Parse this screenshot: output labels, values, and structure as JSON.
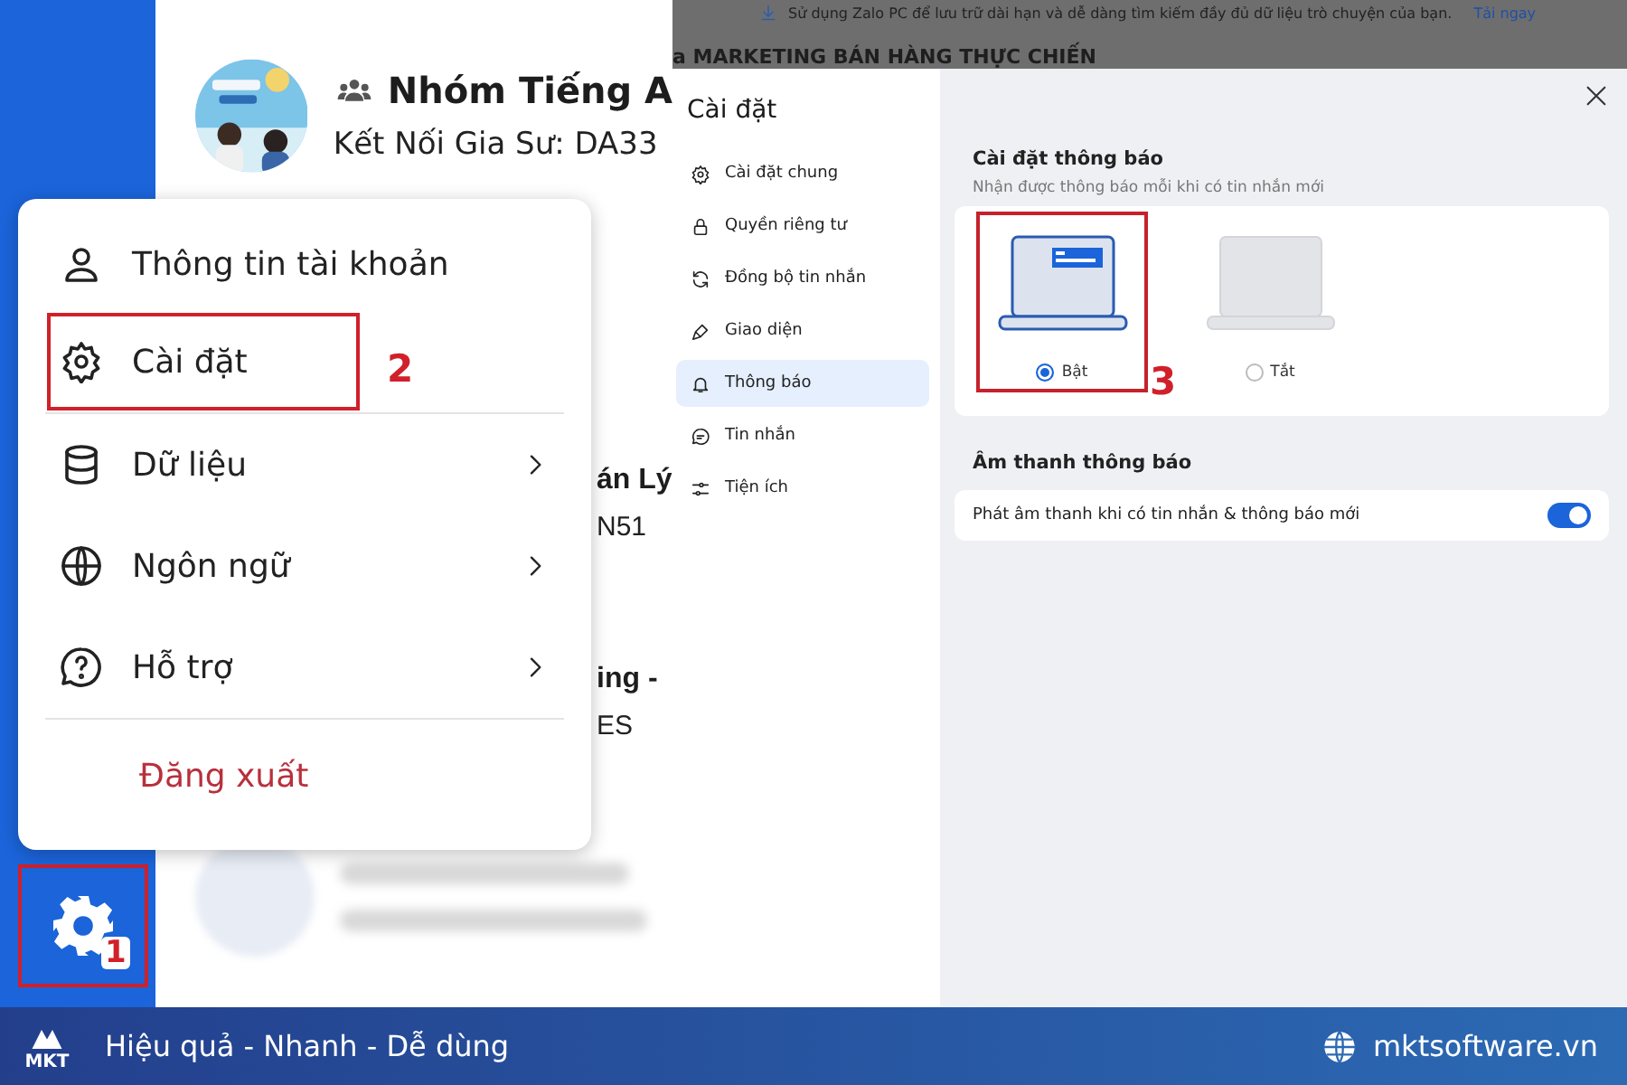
{
  "sidebar": {
    "settings_button": {
      "highlighted": true
    }
  },
  "banner": {
    "text": "Sử dụng Zalo PC để lưu trữ dài hạn và dễ dàng tìm kiếm đầy đủ dữ liệu trò chuyện của bạn.",
    "link": "Tải ngay"
  },
  "chat_header": "a MARKETING BÁN HÀNG THỰC CHIẾN",
  "chats": [
    {
      "kind": "group",
      "title": "Nhóm Tiếng A",
      "subtitle": "Kết Nối Gia Sư: DA33"
    },
    {
      "kind": "partial",
      "title": "án Lý",
      "subtitle": "N51"
    },
    {
      "kind": "partial",
      "title": "ing -",
      "subtitle": "ES"
    },
    {
      "kind": "blurred"
    }
  ],
  "account_menu": {
    "groups": [
      {
        "items": [
          {
            "label": "Thông tin tài khoản",
            "submenu": false,
            "kind": "normal",
            "highlighted": false
          },
          {
            "label": "Cài đặt",
            "submenu": false,
            "kind": "normal",
            "highlighted": true
          }
        ]
      },
      {
        "items": [
          {
            "label": "Dữ liệu",
            "submenu": true,
            "kind": "normal",
            "highlighted": false
          },
          {
            "label": "Ngôn ngữ",
            "submenu": true,
            "kind": "normal",
            "highlighted": false
          },
          {
            "label": "Hỗ trợ",
            "submenu": true,
            "kind": "normal",
            "highlighted": false
          }
        ]
      },
      {
        "items": [
          {
            "label": "Đăng xuất",
            "submenu": false,
            "kind": "danger",
            "highlighted": false
          }
        ]
      }
    ]
  },
  "settings": {
    "title": "Cài đặt",
    "nav": [
      {
        "label": "Cài đặt chung",
        "selected": false
      },
      {
        "label": "Quyền riêng tư",
        "selected": false
      },
      {
        "label": "Đồng bộ tin nhắn",
        "selected": false
      },
      {
        "label": "Giao diện",
        "selected": false
      },
      {
        "label": "Thông báo",
        "selected": true
      },
      {
        "label": "Tin nhắn",
        "selected": false
      },
      {
        "label": "Tiện ích",
        "selected": false
      }
    ],
    "sections": [
      {
        "kind": "options",
        "title": "Cài đặt thông báo",
        "subtitle": "Nhận được thông báo mỗi khi có tin nhắn mới",
        "options": [
          {
            "label": "Bật",
            "selected": true,
            "highlighted": true
          },
          {
            "label": "Tắt",
            "selected": false,
            "highlighted": false
          }
        ]
      },
      {
        "kind": "toggles",
        "title": "Âm thanh thông báo",
        "rows": [
          {
            "label": "Phát âm thanh khi có tin nhắn & thông báo mới",
            "on": true
          }
        ]
      }
    ]
  },
  "annotations": [
    {
      "label": "1"
    },
    {
      "label": "2"
    },
    {
      "label": "3"
    }
  ],
  "footer": {
    "logo_text": "MKT",
    "tagline": "Hiệu quả - Nhanh - Dễ dùng",
    "website": "mktsoftware.vn"
  }
}
